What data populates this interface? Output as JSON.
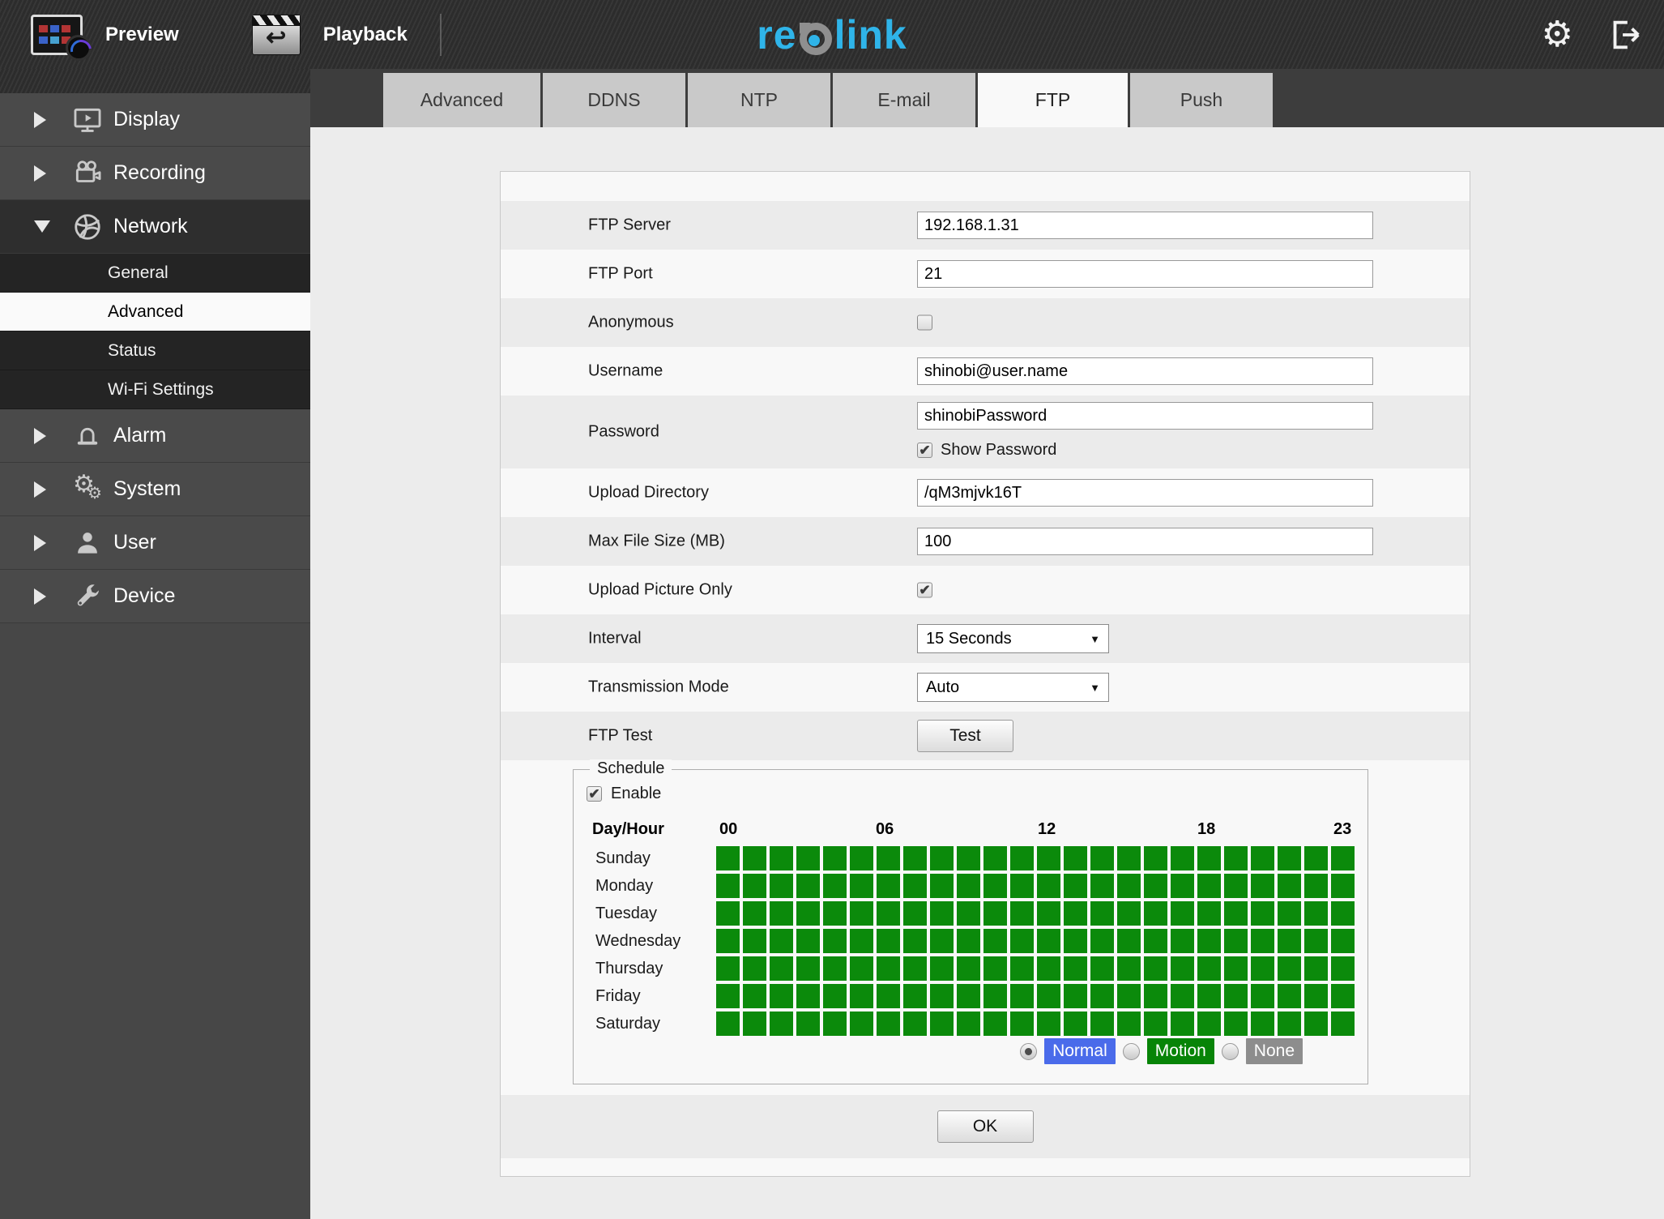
{
  "topbar": {
    "preview_label": "Preview",
    "playback_label": "Playback",
    "logo": {
      "part1": "re",
      "part2": "link",
      "accent_color": "#2fb4e9",
      "o_color": "#8f8f8f"
    },
    "icons": [
      "preview-icon",
      "playback-icon",
      "gear-icon",
      "logout-icon"
    ]
  },
  "sidebar": {
    "items": [
      {
        "label": "Display",
        "icon": "monitor-play-icon",
        "state": "collapsed"
      },
      {
        "label": "Recording",
        "icon": "video-camera-icon",
        "state": "collapsed"
      },
      {
        "label": "Network",
        "icon": "globe-icon",
        "state": "expanded"
      },
      {
        "label": "Alarm",
        "icon": "siren-icon",
        "state": "collapsed"
      },
      {
        "label": "System",
        "icon": "gears-icon",
        "state": "collapsed"
      },
      {
        "label": "User",
        "icon": "user-icon",
        "state": "collapsed"
      },
      {
        "label": "Device",
        "icon": "wrench-icon",
        "state": "collapsed"
      }
    ],
    "network_subitems": [
      {
        "label": "General",
        "selected": false
      },
      {
        "label": "Advanced",
        "selected": true
      },
      {
        "label": "Status",
        "selected": false
      },
      {
        "label": "Wi-Fi Settings",
        "selected": false
      }
    ]
  },
  "tabs": {
    "items": [
      {
        "label": "Advanced",
        "active": false
      },
      {
        "label": "DDNS",
        "active": false
      },
      {
        "label": "NTP",
        "active": false
      },
      {
        "label": "E-mail",
        "active": false
      },
      {
        "label": "FTP",
        "active": true
      },
      {
        "label": "Push",
        "active": false
      }
    ]
  },
  "form": {
    "ftp_server": {
      "label": "FTP Server",
      "value": "192.168.1.31"
    },
    "ftp_port": {
      "label": "FTP Port",
      "value": "21"
    },
    "anonymous": {
      "label": "Anonymous",
      "checked": false
    },
    "username": {
      "label": "Username",
      "value": "shinobi@user.name"
    },
    "password": {
      "label": "Password",
      "value": "shinobiPassword",
      "show_password_label": "Show Password",
      "show_password_checked": true
    },
    "upload_directory": {
      "label": "Upload Directory",
      "value": "/qM3mjvk16T"
    },
    "max_file_size": {
      "label": "Max File Size (MB)",
      "value": "100"
    },
    "upload_picture_only": {
      "label": "Upload Picture Only",
      "checked": true
    },
    "interval": {
      "label": "Interval",
      "value": "15 Seconds"
    },
    "transmission_mode": {
      "label": "Transmission Mode",
      "value": "Auto"
    },
    "ftp_test": {
      "label": "FTP Test",
      "button_label": "Test"
    }
  },
  "schedule": {
    "legend": "Schedule",
    "enable_label": "Enable",
    "enabled": true,
    "day_hour_label": "Day/Hour",
    "hour_labels": [
      "00",
      "06",
      "12",
      "18",
      "23"
    ],
    "columns": 24,
    "rows": [
      {
        "day": "Sunday",
        "all": "motion"
      },
      {
        "day": "Monday",
        "all": "motion"
      },
      {
        "day": "Tuesday",
        "all": "motion"
      },
      {
        "day": "Wednesday",
        "all": "motion"
      },
      {
        "day": "Thursday",
        "all": "motion"
      },
      {
        "day": "Friday",
        "all": "motion"
      },
      {
        "day": "Saturday",
        "all": "motion"
      }
    ],
    "modes": [
      {
        "label": "Normal",
        "value": "normal",
        "color": "#4a6bea",
        "selected": true
      },
      {
        "label": "Motion",
        "value": "motion",
        "color": "#078407",
        "selected": false
      },
      {
        "label": "None",
        "value": "none",
        "color": "#8d8d8d",
        "selected": false
      }
    ],
    "cell_color": "#0b8a0b"
  },
  "ok_button": {
    "label": "OK"
  }
}
